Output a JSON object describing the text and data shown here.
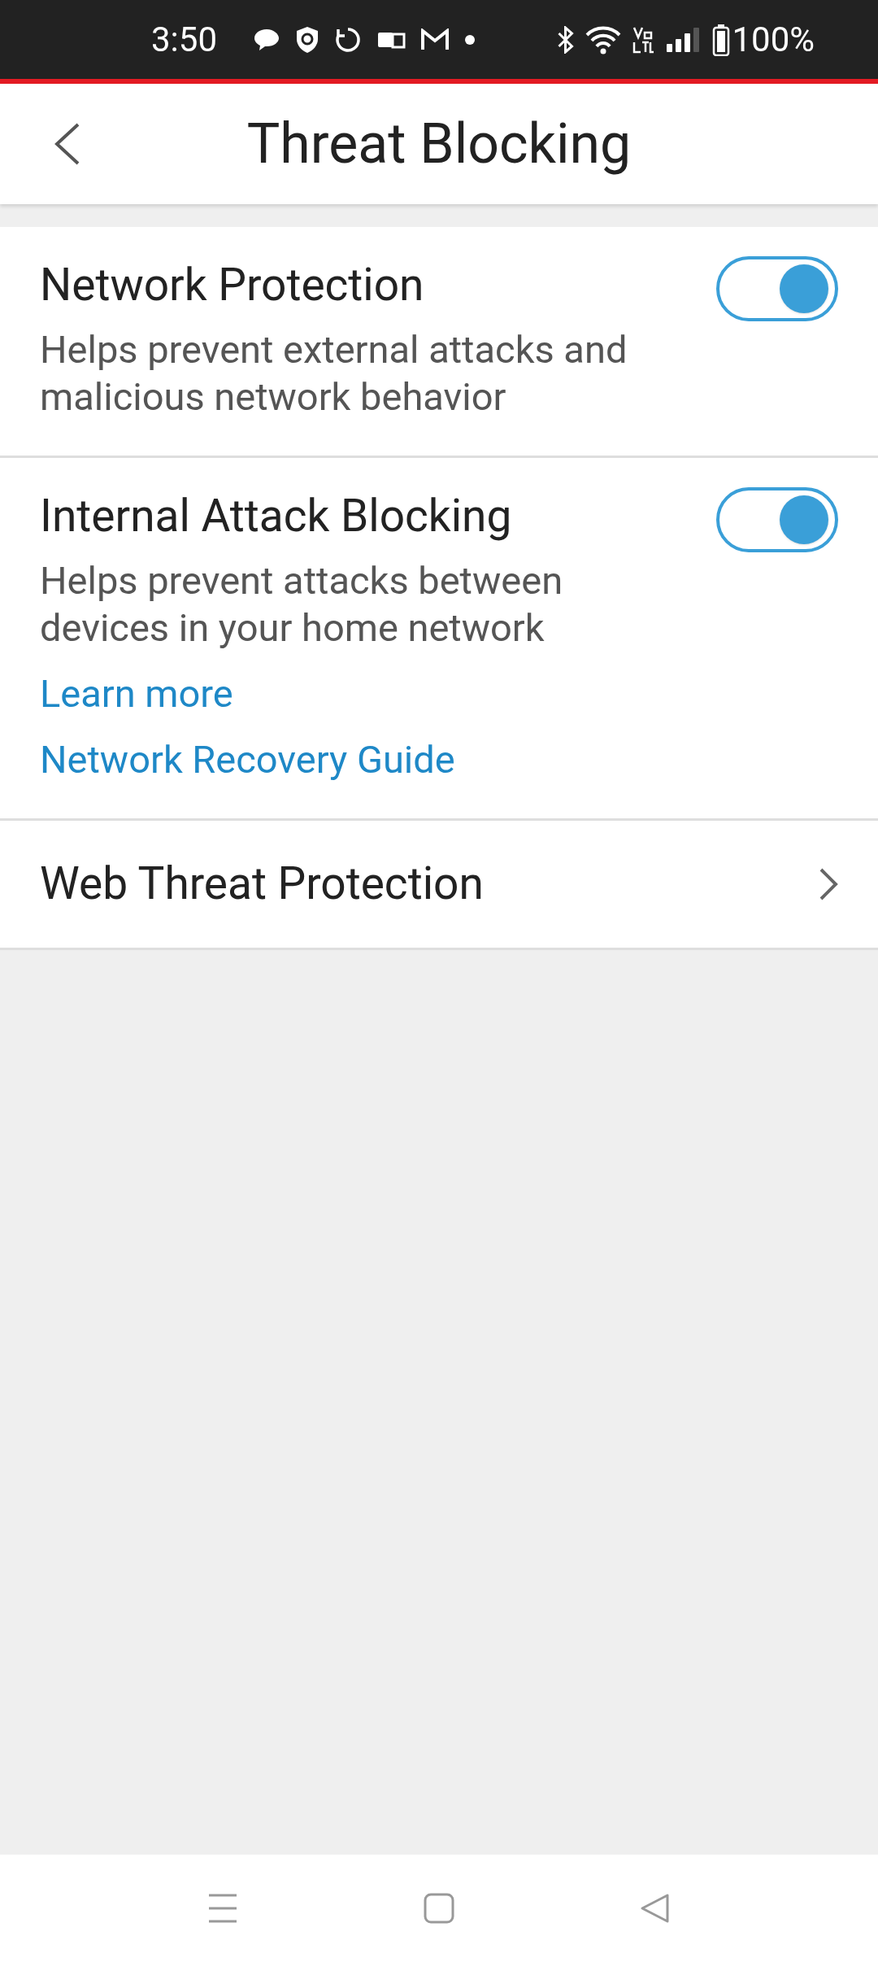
{
  "status_bar": {
    "time": "3:50",
    "battery": "100%"
  },
  "header": {
    "title": "Threat Blocking"
  },
  "settings": [
    {
      "kind": "toggle",
      "title": "Network Protection",
      "description": "Helps prevent external attacks and malicious network behavior",
      "on": true
    },
    {
      "kind": "toggle",
      "title": "Internal Attack Blocking",
      "description": "Helps prevent attacks between devices in your home network",
      "on": true,
      "links": [
        "Learn more",
        "Network Recovery Guide"
      ]
    },
    {
      "kind": "link",
      "title": "Web Threat Protection"
    }
  ]
}
